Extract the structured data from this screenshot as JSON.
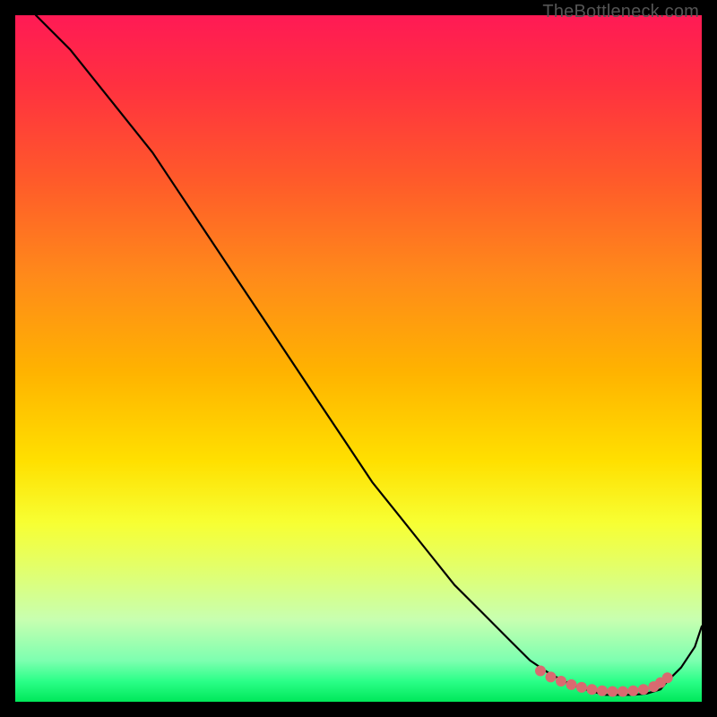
{
  "attribution": "TheBottleneck.com",
  "chart_data": {
    "type": "line",
    "title": "",
    "xlabel": "",
    "ylabel": "",
    "xlim": [
      0,
      100
    ],
    "ylim": [
      0,
      100
    ],
    "grid": false,
    "legend": false,
    "series": [
      {
        "name": "curve",
        "color": "#000000",
        "x": [
          3,
          8,
          12,
          16,
          20,
          24,
          28,
          32,
          36,
          40,
          44,
          48,
          52,
          56,
          60,
          64,
          68,
          72,
          75,
          78,
          81,
          84,
          86,
          88,
          90,
          92,
          94,
          95,
          97,
          99,
          100
        ],
        "y": [
          100,
          95,
          90,
          85,
          80,
          74,
          68,
          62,
          56,
          50,
          44,
          38,
          32,
          27,
          22,
          17,
          13,
          9,
          6,
          4,
          2.5,
          1.5,
          1,
          1,
          1,
          1.2,
          1.8,
          3,
          5,
          8,
          11
        ]
      }
    ],
    "markers": [
      {
        "name": "highlight-dots",
        "color": "#d96a70",
        "radius": 6,
        "x": [
          76.5,
          78,
          79.5,
          81,
          82.5,
          84,
          85.5,
          87,
          88.5,
          90,
          91.5,
          93,
          94,
          95
        ],
        "y": [
          4.5,
          3.6,
          3.0,
          2.5,
          2.1,
          1.8,
          1.6,
          1.5,
          1.5,
          1.6,
          1.8,
          2.2,
          2.8,
          3.5
        ]
      }
    ],
    "background_gradient": {
      "top_color": "#ff1a55",
      "bottom_color": "#00e85a"
    }
  }
}
